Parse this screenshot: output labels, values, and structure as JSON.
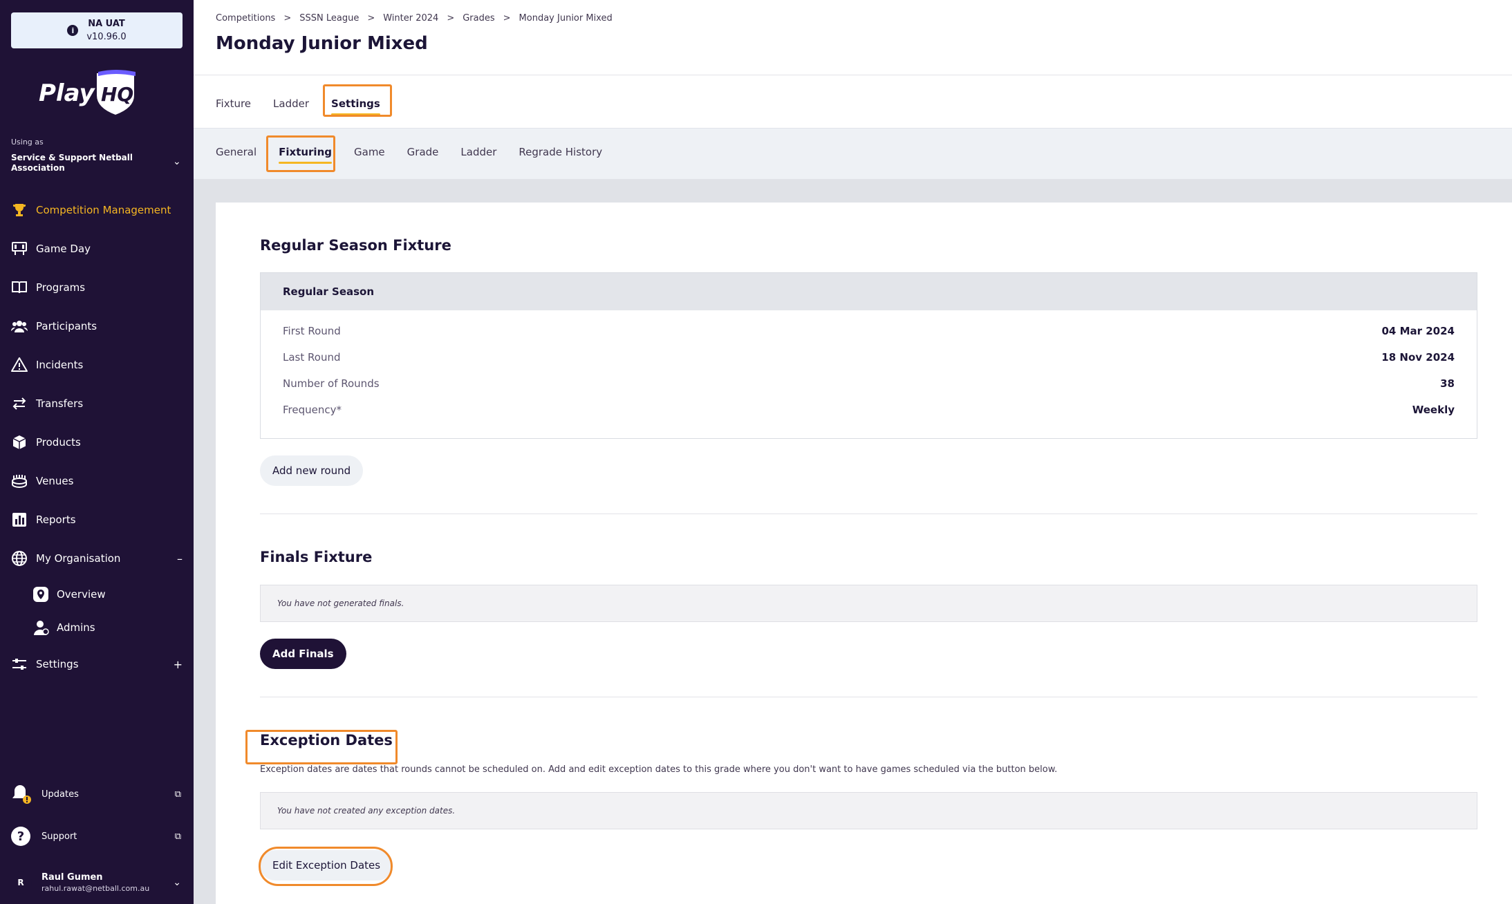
{
  "env": {
    "name": "NA UAT",
    "version": "v10.96.0"
  },
  "brand": {
    "logo_text": "PlayHQ",
    "accent": "#f5b622",
    "sidebar_bg": "#1f1236",
    "highlight": "#f08a2b"
  },
  "sidebar": {
    "using_as_label": "Using as",
    "org_name": "Service & Support Netball Association",
    "nav": [
      {
        "label": "Competition Management",
        "icon": "trophy-icon"
      },
      {
        "label": "Game Day",
        "icon": "scoreboard-icon"
      },
      {
        "label": "Programs",
        "icon": "book-icon"
      },
      {
        "label": "Participants",
        "icon": "people-icon"
      },
      {
        "label": "Incidents",
        "icon": "warning-icon"
      },
      {
        "label": "Transfers",
        "icon": "transfer-icon"
      },
      {
        "label": "Products",
        "icon": "box-icon"
      },
      {
        "label": "Venues",
        "icon": "stadium-icon"
      },
      {
        "label": "Reports",
        "icon": "chart-icon"
      },
      {
        "label": "My Organisation",
        "icon": "globe-icon",
        "toggle": "–"
      },
      {
        "label": "Settings",
        "icon": "sliders-icon",
        "toggle": "+"
      }
    ],
    "sub_items": [
      {
        "label": "Overview",
        "icon": "location-pin-icon"
      },
      {
        "label": "Admins",
        "icon": "admin-user-icon"
      }
    ],
    "updates_label": "Updates",
    "support_label": "Support",
    "user": {
      "initial": "R",
      "name": "Raul Gumen",
      "email": "rahul.rawat@netball.com.au"
    }
  },
  "breadcrumb": [
    "Competitions",
    "SSSN League",
    "Winter 2024",
    "Grades",
    "Monday Junior Mixed"
  ],
  "page_title": "Monday Junior Mixed",
  "tabs": [
    "Fixture",
    "Ladder",
    "Settings"
  ],
  "subtabs": [
    "General",
    "Fixturing",
    "Game",
    "Grade",
    "Ladder",
    "Regrade History"
  ],
  "regular": {
    "title": "Regular Season Fixture",
    "table_head": "Regular Season",
    "rows": [
      {
        "label": "First Round",
        "value": "04 Mar 2024"
      },
      {
        "label": "Last Round",
        "value": "18 Nov 2024"
      },
      {
        "label": "Number of Rounds",
        "value": "38"
      },
      {
        "label": "Frequency*",
        "value": "Weekly"
      }
    ],
    "add_round_label": "Add new round"
  },
  "finals": {
    "title": "Finals Fixture",
    "empty_text": "You have not generated finals.",
    "add_label": "Add Finals"
  },
  "exceptions": {
    "title": "Exception Dates",
    "description": "Exception dates are dates that rounds cannot be scheduled on. Add and edit exception dates to this grade where you don't want to have games scheduled via the button below.",
    "empty_text": "You have not created any exception dates.",
    "edit_label": "Edit Exception Dates"
  }
}
